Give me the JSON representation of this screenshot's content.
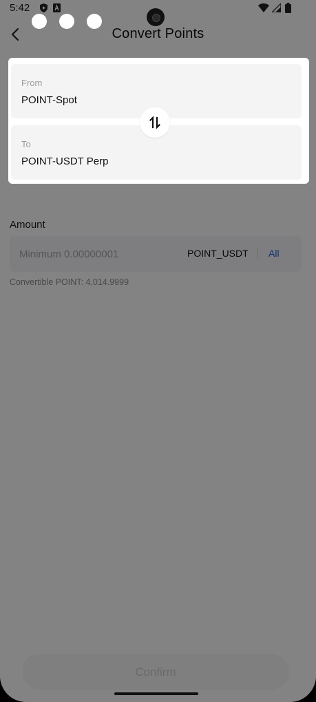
{
  "status_bar": {
    "time": "5:42"
  },
  "header": {
    "title": "Convert Points"
  },
  "convert": {
    "from": {
      "label": "From",
      "value": "POINT-Spot"
    },
    "to": {
      "label": "To",
      "value": "POINT-USDT Perp"
    }
  },
  "amount": {
    "label": "Amount",
    "placeholder": "Minimum 0.00000001",
    "unit": "POINT_USDT",
    "all_label": "All",
    "convertible": "Convertible POINT: 4,014.9999"
  },
  "confirm_label": "Confirm",
  "colors": {
    "accent_link": "#1e5bd8",
    "overlay": "rgba(0,0,0,0.47)"
  },
  "icons": [
    "back-arrow-icon",
    "swap-icon",
    "wifi-icon",
    "signal-icon",
    "battery-icon",
    "shield-play-icon",
    "a-icon"
  ]
}
